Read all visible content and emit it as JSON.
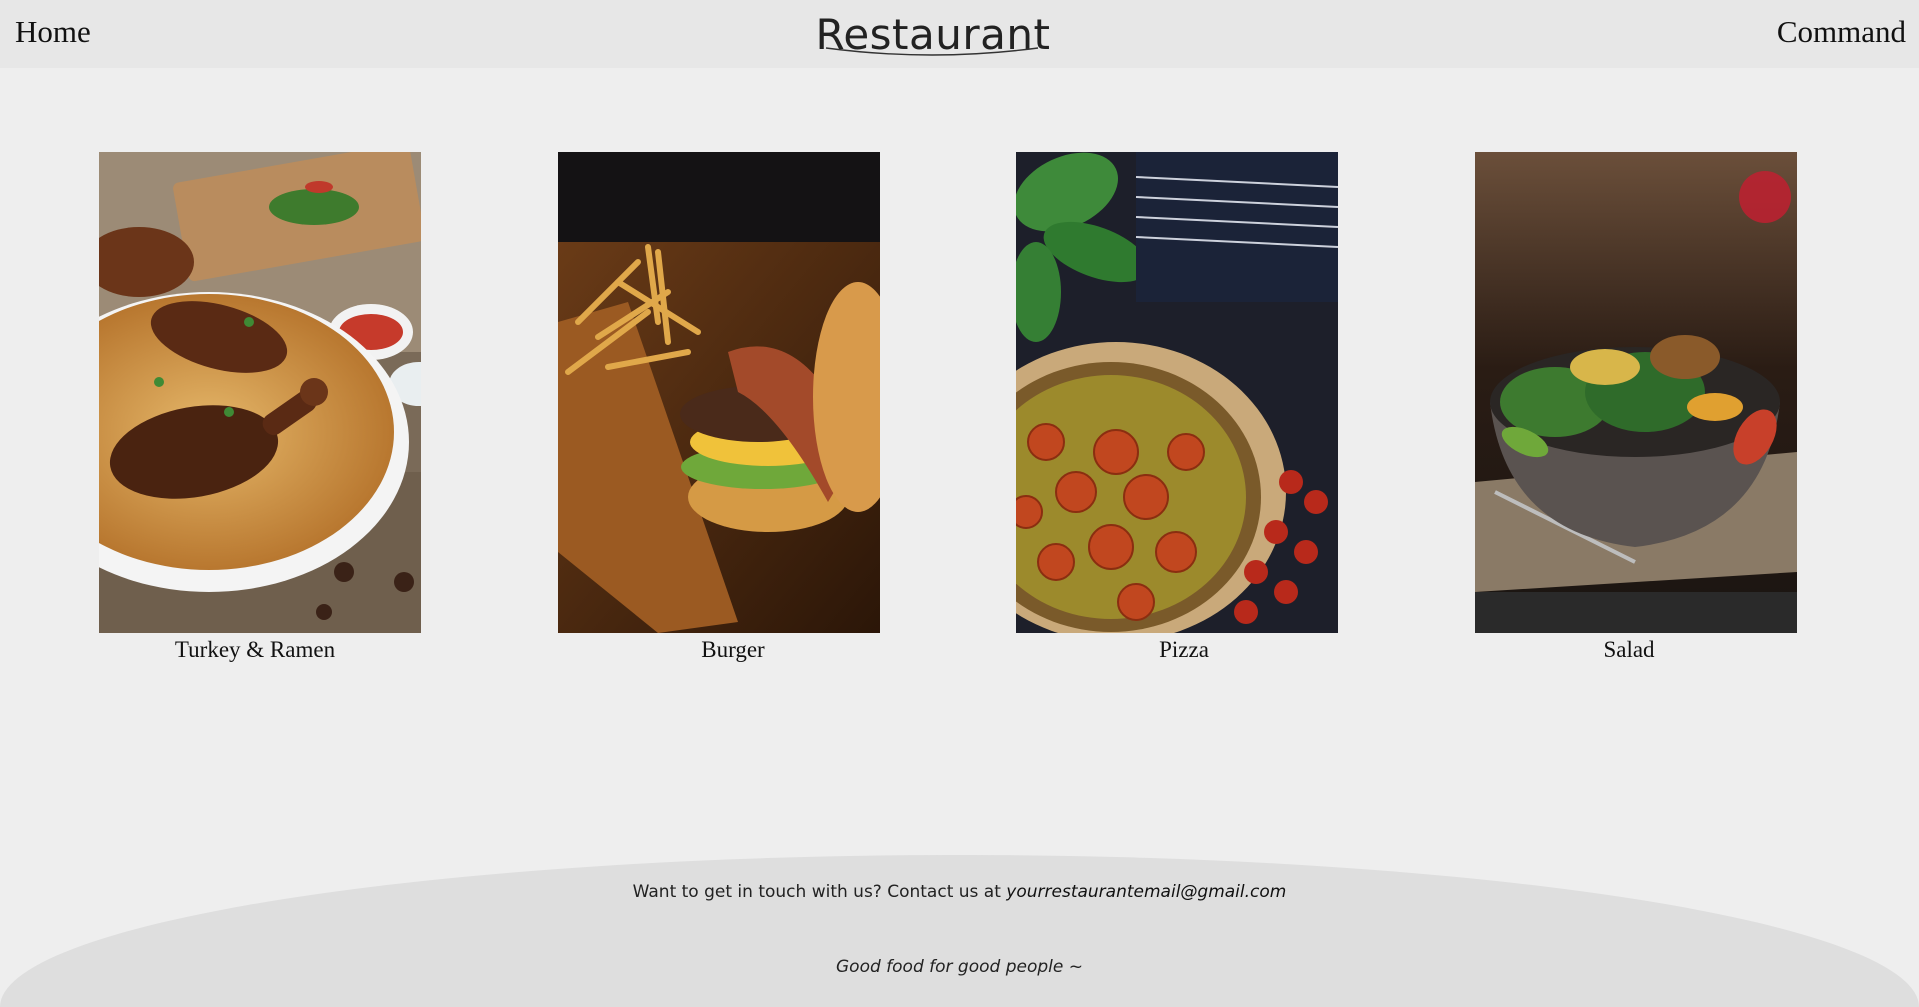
{
  "header": {
    "home_label": "Home",
    "brand": "Restaurant",
    "command_label": "Command"
  },
  "dishes": [
    {
      "label": "Turkey & Ramen",
      "image": "rice-and-roasted-chicken-photo"
    },
    {
      "label": "Burger",
      "image": "burger-and-fries-photo"
    },
    {
      "label": "Pizza",
      "image": "tomato-pizza-photo"
    },
    {
      "label": "Salad",
      "image": "salad-bowl-photo"
    }
  ],
  "footer": {
    "contact_text": "Want to get in touch with us? Contact us at",
    "email": "yourrestaurantemail@gmail.com",
    "tagline": "Good food for good people ~"
  },
  "colors": {
    "background": "#eeeeee",
    "header": "#e7e7e7",
    "footer": "#dedede",
    "text": "#111111"
  }
}
